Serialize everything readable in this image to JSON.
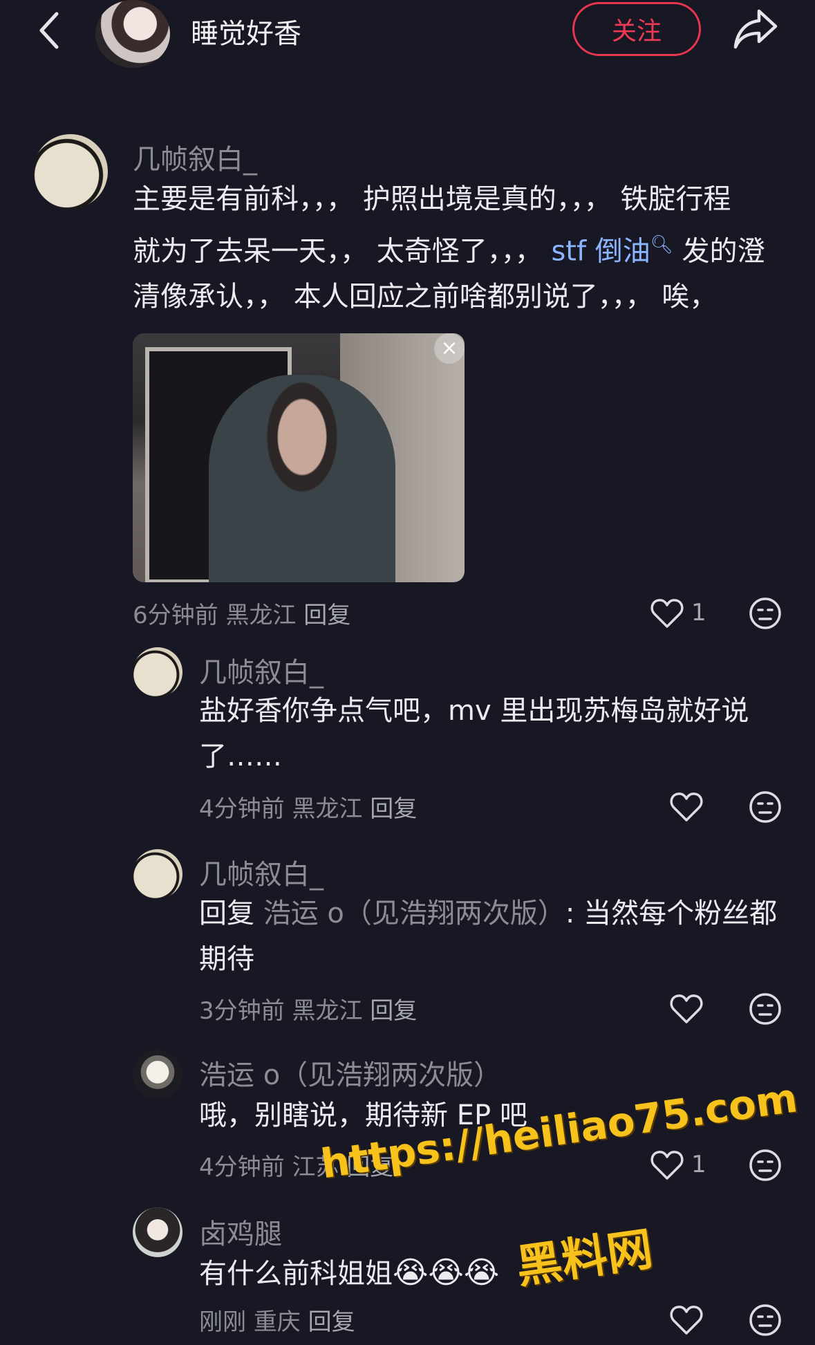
{
  "header": {
    "username": "睡觉好香",
    "follow_label": "关注"
  },
  "comments": [
    {
      "name": "几帧叙白_",
      "lines": [
        "主要是有前科，，，  护照出境是真的，，，  铁腚行程",
        "就为了去呆一天，，  太奇怪了，，，"
      ],
      "line2_link": "stf 倒油",
      "line2_after": " 发的澄",
      "line3": "清像承认，，  本人回应之前啥都别说了，，，  唉，",
      "time": "6分钟前",
      "location": "黑龙江",
      "reply": "回复",
      "likes": "1"
    },
    {
      "name": "几帧叙白_",
      "lines": [
        "盐好香你争点气吧，mv 里出现苏梅岛就好说",
        "了……"
      ],
      "time": "4分钟前",
      "location": "黑龙江",
      "reply": "回复"
    },
    {
      "name": "几帧叙白_",
      "reply_prefix": "回复 ",
      "reply_to": "浩运 o（见浩翔两次版）",
      "reply_text": ": 当然每个粉丝都",
      "line2": "期待",
      "time": "3分钟前",
      "location": "黑龙江",
      "reply": "回复"
    },
    {
      "name": "浩运 o（见浩翔两次版）",
      "text": "哦，别瞎说，期待新 EP 吧",
      "time": "4分钟前",
      "location": "江苏",
      "reply": "回复",
      "likes": "1"
    },
    {
      "name": "卤鸡腿",
      "text": "有什么前科姐姐",
      "emojis": "😭😭😭",
      "time": "刚刚",
      "location": "重庆",
      "reply": "回复"
    }
  ],
  "watermark": {
    "url": "https://heiliao75.com",
    "site": "黑料网"
  },
  "icons": {
    "back": "chevron-left-icon",
    "share": "share-arrow-icon",
    "like": "heart-outline-icon",
    "react": "neutral-face-icon",
    "close": "close-icon"
  }
}
